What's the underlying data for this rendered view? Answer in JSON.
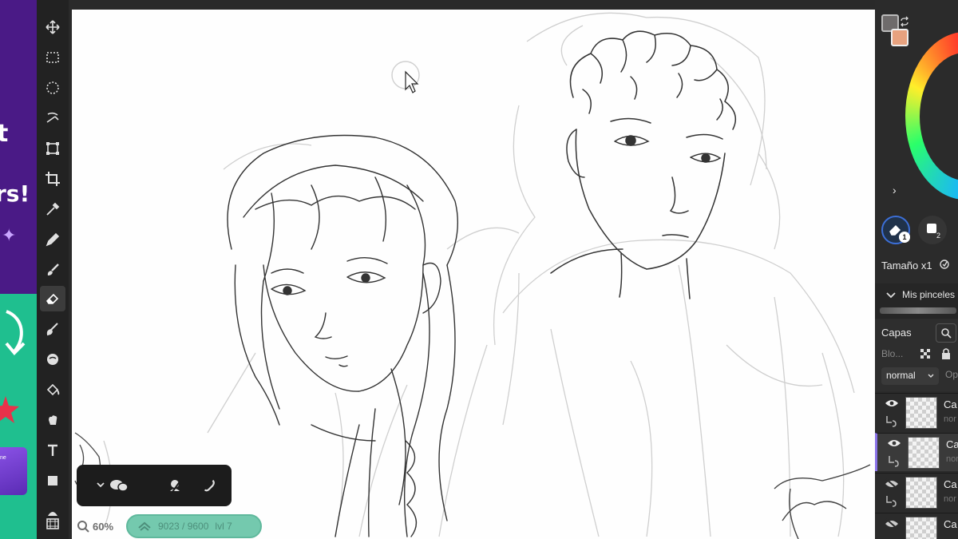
{
  "promo": {
    "line_a": "t",
    "line_b": "rs!",
    "card_text": "ne"
  },
  "colors": {
    "toolbar_bg": "#222222",
    "panel_bg": "#2b2b2b",
    "primary_swatch": "#e7a27f",
    "secondary_swatch": "#6e6b6b",
    "accent_selected_layer": "#8a73e8",
    "pixel_pill": "#74c9ae"
  },
  "tools": [
    "move-tool-icon",
    "rect-select-icon",
    "lasso-select-icon",
    "magic-wand-icon",
    "transform-icon",
    "crop-icon",
    "eyedropper-icon",
    "pen-icon",
    "brush-icon",
    "eraser-icon",
    "smudge-icon",
    "blur-icon",
    "fill-bucket-icon",
    "hand-icon",
    "text-icon",
    "shape-icon",
    "filmstrip-icon"
  ],
  "status": {
    "zoom": "60%",
    "pixel_usage": "9023 / 9600",
    "level": "lvl 7"
  },
  "brush": {
    "slot1_number": "1",
    "slot2_number": "2",
    "size_label": "Tamaño x1",
    "library_label": "Mis pinceles"
  },
  "layers_panel": {
    "title": "Capas",
    "blend_label": "Blo...",
    "blend_mode": "normal",
    "opacity_label": "Op",
    "layers": [
      {
        "name": "Ca",
        "mode": "nor",
        "visible": true
      },
      {
        "name": "Ca",
        "mode": "nor",
        "visible": true
      },
      {
        "name": "Ca",
        "mode": "nor",
        "visible": false
      },
      {
        "name": "Ca",
        "mode": "",
        "visible": false
      }
    ]
  }
}
